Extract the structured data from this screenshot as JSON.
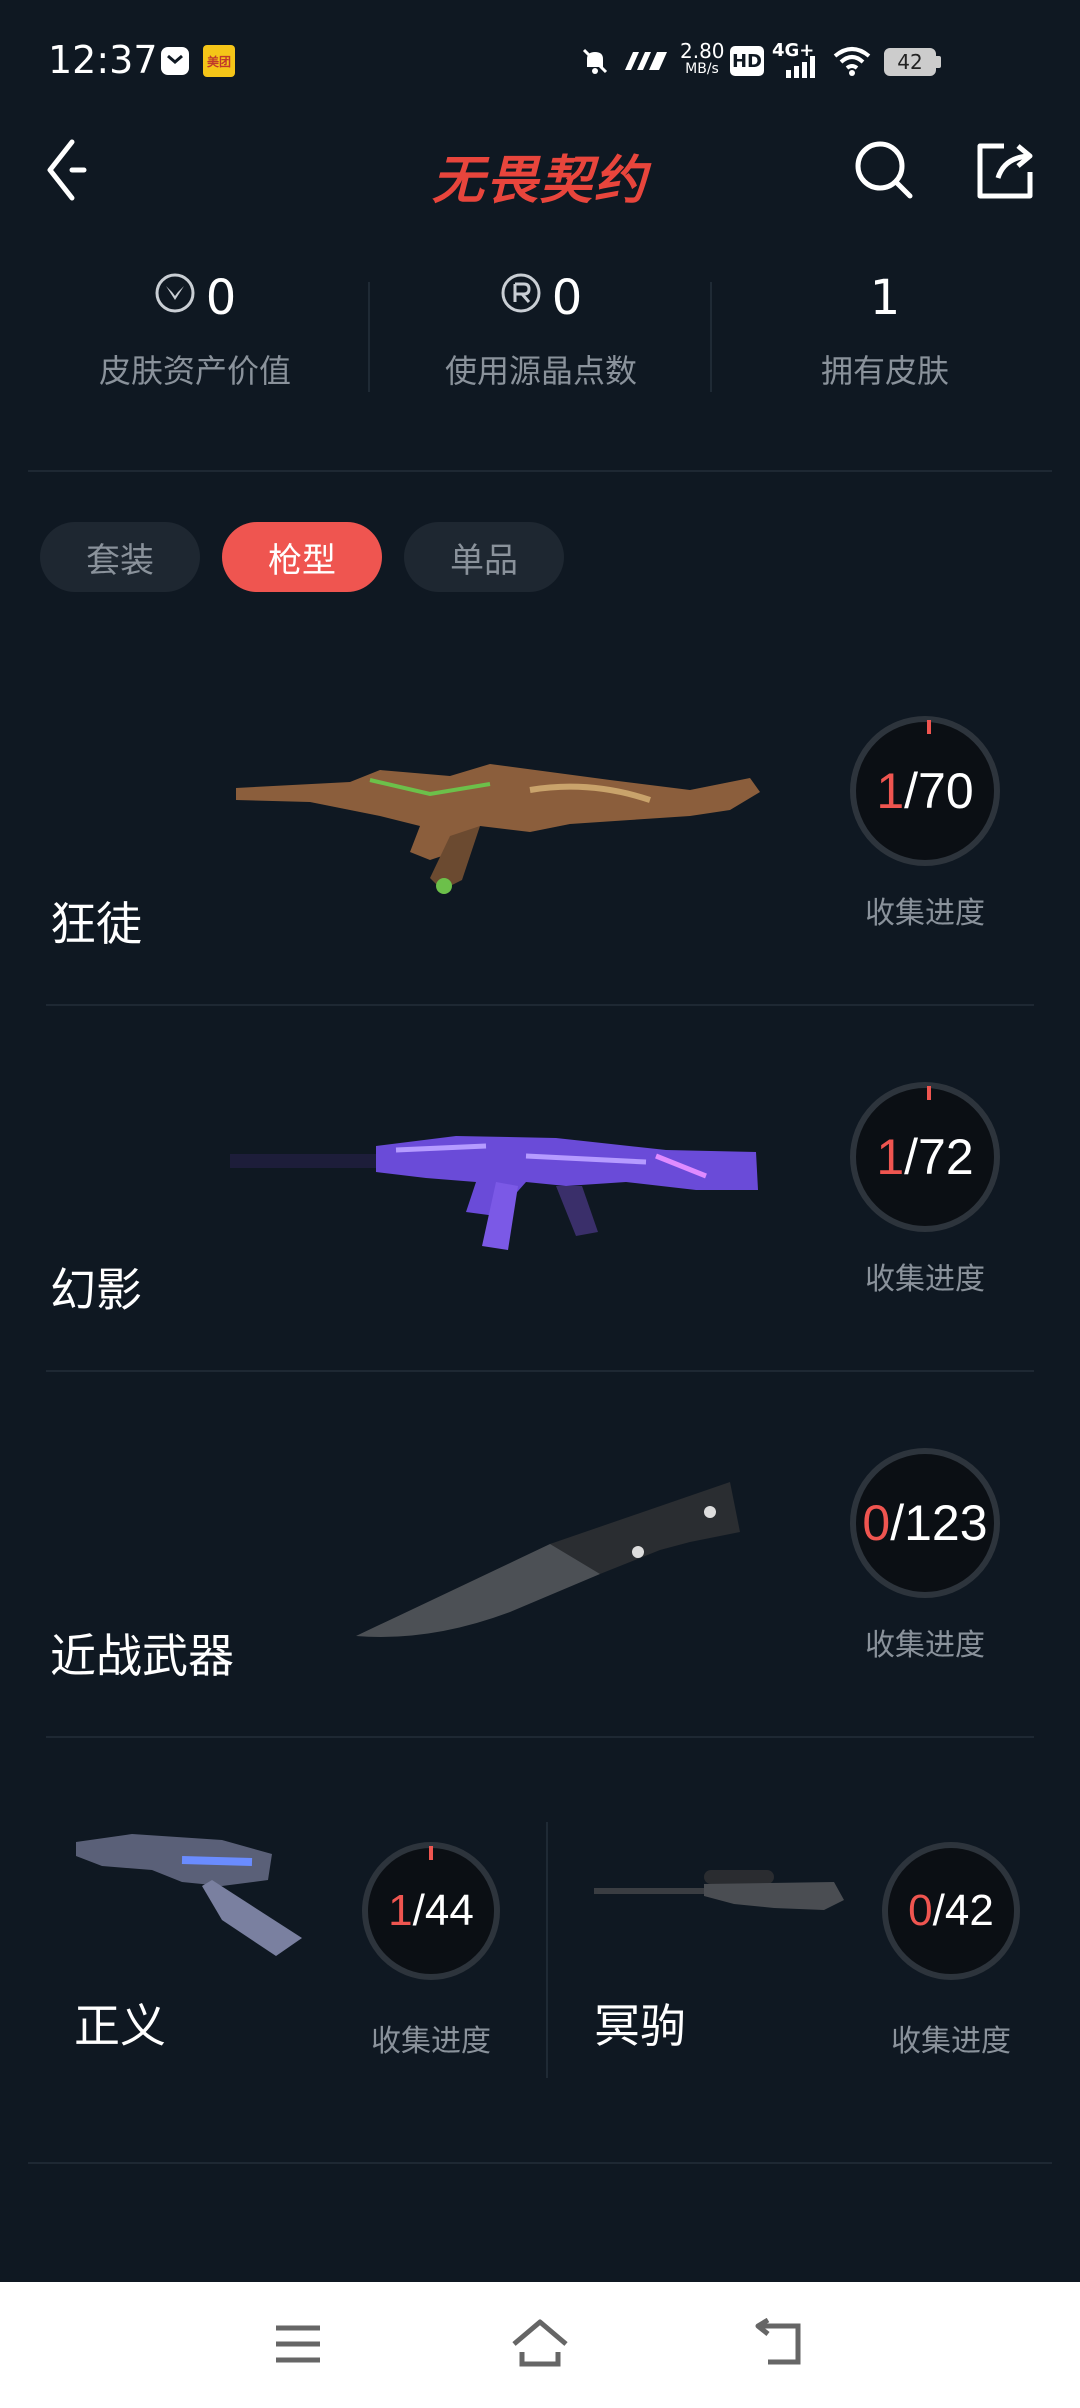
{
  "status_bar": {
    "time": "12:37",
    "net_speed_value": "2.80",
    "net_speed_unit": "MB/s",
    "hd": "HD",
    "signal": "4G+",
    "battery": "42",
    "app_badge": "美团"
  },
  "header": {
    "title": "无畏契约"
  },
  "stats": [
    {
      "value": "0",
      "label": "皮肤资产价值",
      "icon": "valorant-points-icon"
    },
    {
      "value": "0",
      "label": "使用源晶点数",
      "icon": "radianite-icon"
    },
    {
      "value": "1",
      "label": "拥有皮肤"
    }
  ],
  "tabs": [
    {
      "label": "套装",
      "active": false
    },
    {
      "label": "枪型",
      "active": true
    },
    {
      "label": "单品",
      "active": false
    }
  ],
  "weapons": [
    {
      "name": "狂徒",
      "owned": "1",
      "total": "/70",
      "progress_label": "收集进度",
      "progress": 0.014
    },
    {
      "name": "幻影",
      "owned": "1",
      "total": "/72",
      "progress_label": "收集进度",
      "progress": 0.014
    },
    {
      "name": "近战武器",
      "owned": "0",
      "total": "/123",
      "progress_label": "收集进度",
      "progress": 0
    }
  ],
  "weapons_small": [
    {
      "name": "正义",
      "owned": "1",
      "total": "/44",
      "progress_label": "收集进度",
      "progress": 0.023
    },
    {
      "name": "冥驹",
      "owned": "0",
      "total": "/42",
      "progress_label": "收集进度",
      "progress": 0
    }
  ],
  "colors": {
    "accent": "#ef5550",
    "background": "#0f1822"
  }
}
